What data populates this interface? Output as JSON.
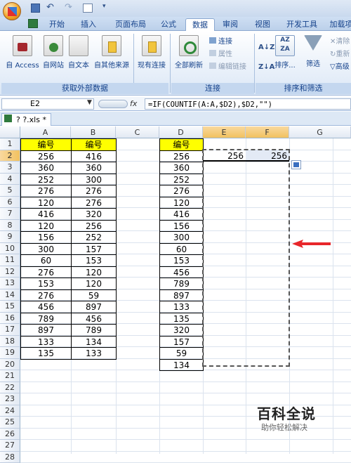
{
  "quick_access": {
    "app_icon": "office-orb-icon",
    "undo_icon": "undo-icon",
    "redo_icon": "redo-icon",
    "print_icon": "print-preview-icon"
  },
  "tabs": [
    "开始",
    "插入",
    "页面布局",
    "公式",
    "数据",
    "审阅",
    "视图",
    "开发工具",
    "加载项"
  ],
  "active_tab": "数据",
  "ribbon": {
    "external_data": {
      "label": "获取外部数据",
      "buttons": [
        "自 Access",
        "自网站",
        "自文本",
        "自其他来源",
        "现有连接"
      ]
    },
    "connections": {
      "label": "连接",
      "refresh": "全部刷新",
      "items": [
        "连接",
        "属性",
        "编辑链接"
      ]
    },
    "sort_filter": {
      "label": "排序和筛选",
      "sort": "排序...",
      "filter": "筛选",
      "items": [
        "清除",
        "重新",
        "高级"
      ]
    }
  },
  "formula_bar": {
    "name_box": "E2",
    "fx": "fx",
    "formula": "=IF(COUNTIF(A:A,$D2),$D2,\"\")"
  },
  "document_tab": "? ?.xls *",
  "columns": [
    "A",
    "B",
    "C",
    "D",
    "E",
    "F",
    "G"
  ],
  "selected_columns": [
    "E",
    "F"
  ],
  "rows": [
    "1",
    "2",
    "3",
    "4",
    "5",
    "6",
    "7",
    "8",
    "9",
    "10",
    "11",
    "12",
    "13",
    "14",
    "15",
    "16",
    "17",
    "18",
    "19",
    "20",
    "21",
    "22",
    "23",
    "24",
    "25",
    "26",
    "27",
    "28"
  ],
  "header_label": "编号",
  "col_a": [
    "256",
    "360",
    "252",
    "276",
    "120",
    "416",
    "120",
    "156",
    "300",
    "60",
    "276",
    "153",
    "276",
    "456",
    "789",
    "897",
    "133",
    "135"
  ],
  "col_b": [
    "416",
    "360",
    "300",
    "276",
    "276",
    "320",
    "256",
    "252",
    "157",
    "153",
    "120",
    "120",
    "59",
    "897",
    "456",
    "789",
    "134",
    "133"
  ],
  "col_d": [
    "256",
    "360",
    "252",
    "276",
    "120",
    "416",
    "156",
    "300",
    "60",
    "153",
    "456",
    "789",
    "897",
    "133",
    "135",
    "320",
    "157",
    "59",
    "134"
  ],
  "col_e_f_row2": [
    "256",
    "256"
  ],
  "watermark": {
    "title": "百科全说",
    "subtitle": "助你轻松解决"
  }
}
